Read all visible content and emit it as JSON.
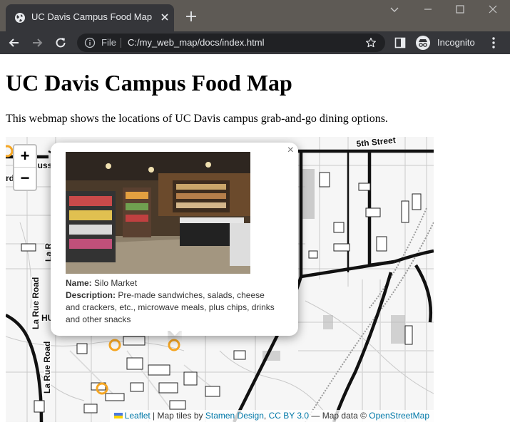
{
  "browser": {
    "tab_title": "UC Davis Campus Food Map",
    "omnibox_scheme": "File",
    "omnibox_url": "C:/my_web_map/docs/index.html",
    "incognito_label": "Incognito"
  },
  "page": {
    "title": "UC Davis Campus Food Map",
    "description": "This webmap shows the locations of UC Davis campus grab-and-go dining options."
  },
  "map": {
    "zoom_in": "+",
    "zoom_out": "−",
    "street_labels": {
      "fifth_street": "5th Street",
      "russell": "Russ",
      "la_rue_road_1": "La Rue Road",
      "la_rue_road_2": "La Rue Road",
      "la_rue_short": "La R",
      "edge_rd": "rd",
      "hu": "HU"
    },
    "popup": {
      "close": "×",
      "name_label": "Name:",
      "name_value": "Silo Market",
      "description_label": "Description:",
      "description_value": "Pre-made sandwiches, salads, cheese and crackers, etc., microwave meals, plus chips, drinks and other snacks"
    },
    "attribution": {
      "leaflet": "Leaflet",
      "tiles_prefix": " | Map tiles by ",
      "stamen": "Stamen Design",
      "sep": ", ",
      "license": "CC BY 3.0",
      "data_prefix": " — Map data © ",
      "osm": "OpenStreetMap"
    },
    "marker_color": "#f5a623"
  }
}
